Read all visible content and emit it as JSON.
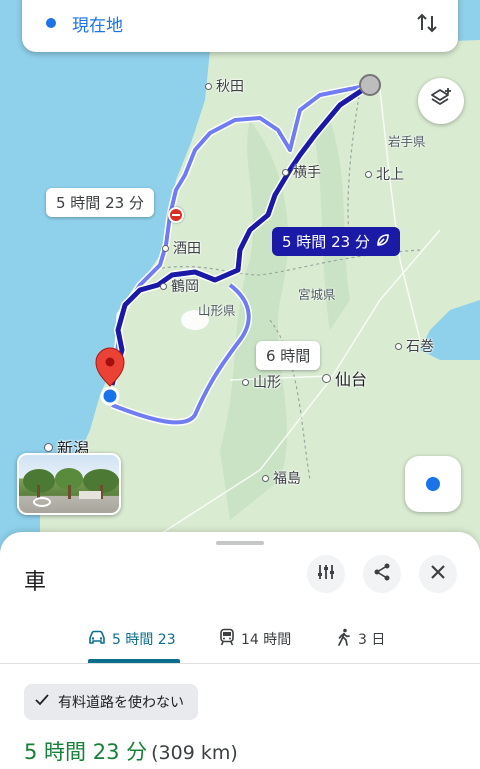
{
  "top_bar": {
    "location_text": "現在地"
  },
  "map": {
    "places": {
      "akita": "秋田",
      "yokote": "横手",
      "kitakami": "北上",
      "sakata": "酒田",
      "tsuruoka": "鶴岡",
      "yamagata": "山形",
      "sendai": "仙台",
      "ishinomaki": "石巻",
      "niigata": "新潟",
      "fukushima": "福島"
    },
    "prefectures": {
      "iwate": "岩手県",
      "yamagata": "山形県",
      "miyagi": "宮城県"
    },
    "route_labels": {
      "alt1": "5 時間 23 分",
      "main": "5 時間 23 分",
      "alt2": "6 時間"
    }
  },
  "sheet": {
    "mode_title": "車",
    "tabs": [
      {
        "label": "5 時間 23",
        "icon": "car-icon",
        "active": true
      },
      {
        "label": "14 時間",
        "icon": "train-icon",
        "active": false
      },
      {
        "label": "3 日",
        "icon": "walk-icon",
        "active": false
      }
    ],
    "chip_label": "有料道路を使わない",
    "summary_time": "5 時間 23 分",
    "summary_distance": "(309 km)"
  },
  "colors": {
    "accent": "#1a73e8",
    "route_main": "#1a1aa6",
    "route_alt": "#6f7cf2",
    "tab_active": "#0b6e8a",
    "summary_time": "#188038",
    "sea": "#8fd0ea",
    "land": "#d9ebd1"
  }
}
